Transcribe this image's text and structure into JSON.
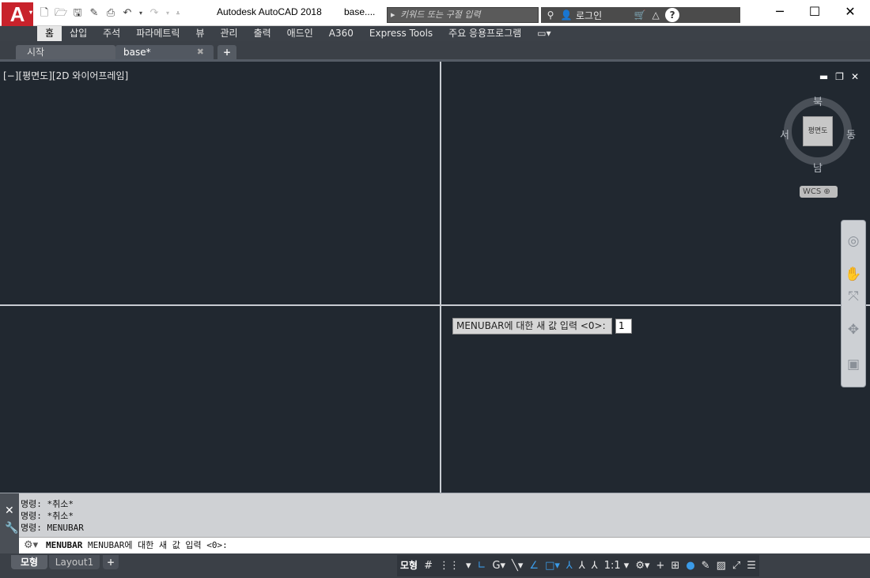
{
  "title": {
    "app": "Autodesk AutoCAD 2018",
    "file": "base....",
    "search_placeholder": "키워드 또는 구절 입력",
    "login": "로그인",
    "app_button": "A",
    "help": "?"
  },
  "window_controls": {
    "minimize": "─",
    "maximize": "☐",
    "close": "✕"
  },
  "ribbon": {
    "tabs": [
      "홈",
      "삽입",
      "주석",
      "파라메트릭",
      "뷰",
      "관리",
      "출력",
      "애드인",
      "A360",
      "Express Tools",
      "주요 응용프로그램"
    ]
  },
  "doc_tabs": {
    "start": "시작",
    "base": "base*",
    "close": "✖",
    "add": "+"
  },
  "viewport": {
    "label": "[−][평면도][2D 와이어프레임]",
    "controls": [
      "▬",
      "❐",
      "✕"
    ],
    "viewcube": {
      "north": "북",
      "south": "남",
      "west": "서",
      "east": "동",
      "face": "평면도"
    },
    "wcs": "WCS ⊕"
  },
  "dynamic_input": {
    "prompt": "MENUBAR에 대한 새 값 입력 <0>:",
    "value": "1"
  },
  "command": {
    "history": [
      "명령: *취소*",
      "명령: *취소*",
      "명령: MENUBAR"
    ],
    "line_cmd": "MENUBAR",
    "line_prompt": "MENUBAR에 대한 새 값 입력 <0>:"
  },
  "layout_tabs": {
    "model": "모형",
    "layout1": "Layout1",
    "add": "+"
  },
  "status": {
    "model_button": "모형",
    "scale": "1:1 ▾"
  },
  "colors": {
    "canvas": "#212830",
    "accent": "#3b9be8",
    "app_red": "#c8222b"
  }
}
